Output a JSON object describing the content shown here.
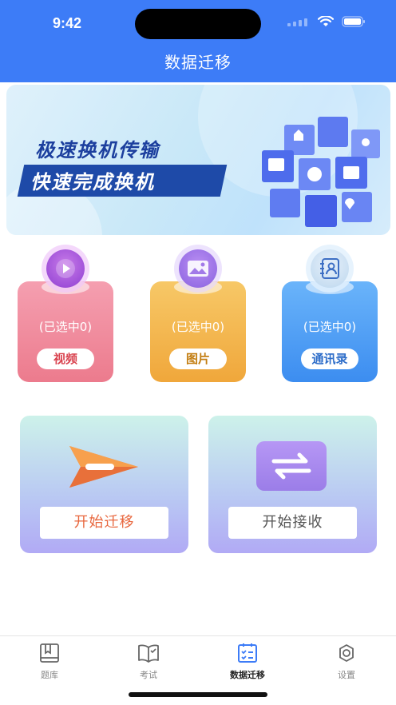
{
  "status_bar": {
    "time": "9:42"
  },
  "header": {
    "title": "数据迁移"
  },
  "banner": {
    "line1": "极速换机传输",
    "line2": "快速完成换机"
  },
  "categories": [
    {
      "label": "视频",
      "status": "(已选中0)",
      "icon": "play-icon"
    },
    {
      "label": "图片",
      "status": "(已选中0)",
      "icon": "image-icon"
    },
    {
      "label": "通讯录",
      "status": "(已选中0)",
      "icon": "contacts-icon"
    }
  ],
  "actions": {
    "migrate_label": "开始迁移",
    "receive_label": "开始接收"
  },
  "tabs": [
    {
      "label": "题库",
      "icon": "book-icon",
      "active": false
    },
    {
      "label": "考试",
      "icon": "open-book-icon",
      "active": false
    },
    {
      "label": "数据迁移",
      "icon": "checklist-icon",
      "active": true
    },
    {
      "label": "设置",
      "icon": "gear-icon",
      "active": false
    }
  ],
  "colors": {
    "primary": "#3d7cf7",
    "video_card": "#ec7b8d",
    "image_card": "#f0a73b",
    "contacts_card": "#3c8df0",
    "migrate_text": "#e8663d"
  }
}
